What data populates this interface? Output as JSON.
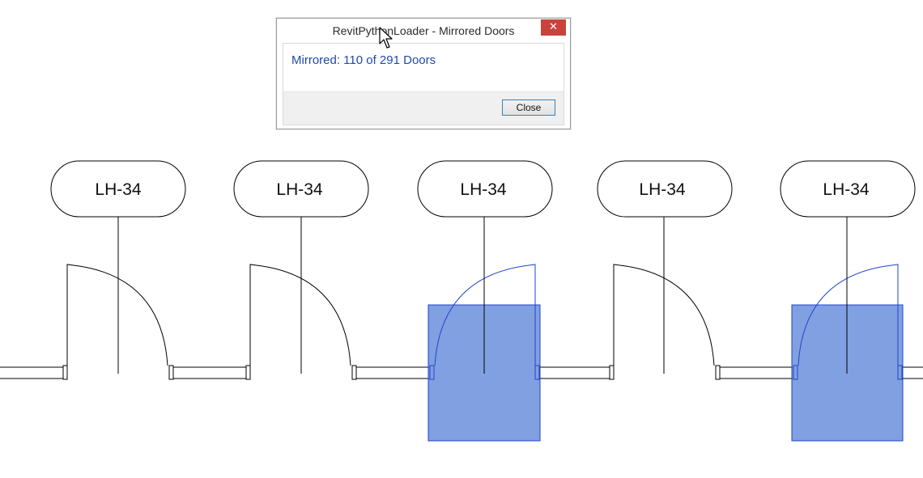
{
  "dialog": {
    "title": "RevitPythonLoader - Mirrored Doors",
    "close_x": "✕",
    "message": "Mirrored: 110 of 291 Doors",
    "close_button": "Close"
  },
  "door_tags": [
    {
      "label": "LH-34",
      "mirrored": false
    },
    {
      "label": "LH-34",
      "mirrored": false
    },
    {
      "label": "LH-34",
      "mirrored": true
    },
    {
      "label": "LH-34",
      "mirrored": false
    },
    {
      "label": "LH-34",
      "mirrored": true
    }
  ],
  "colors": {
    "highlight_fill": "#6b8fdc",
    "highlight_stroke": "#1f45c8",
    "line": "#000000",
    "close_red": "#c7433b",
    "message_blue": "#1f4aa8"
  },
  "icons": {
    "cursor": "mouse-pointer-icon",
    "dialog_close": "close-icon"
  }
}
